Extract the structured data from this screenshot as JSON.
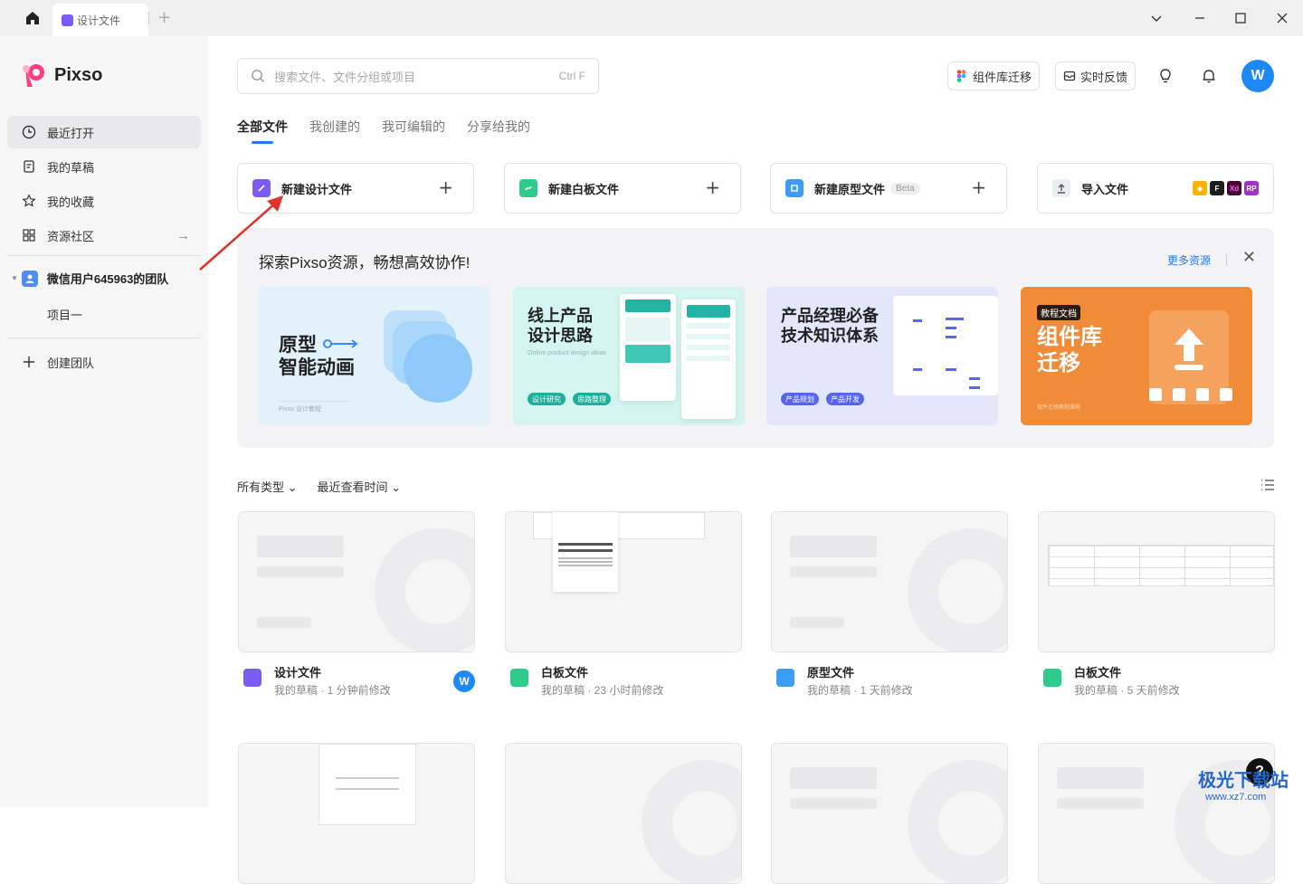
{
  "titlebar": {
    "tab_label": "设计文件"
  },
  "sidebar": {
    "brand": "Pixso",
    "items": [
      {
        "label": "最近打开"
      },
      {
        "label": "我的草稿"
      },
      {
        "label": "我的收藏"
      },
      {
        "label": "资源社区"
      }
    ],
    "team_name": "微信用户645963的团队",
    "project": "项目一",
    "create_team": "创建团队"
  },
  "header": {
    "search_placeholder": "搜索文件、文件分组或项目",
    "search_shortcut": "Ctrl F",
    "migrate_label": "组件库迁移",
    "feedback_label": "实时反馈",
    "avatar_initial": "W"
  },
  "tabs": [
    "全部文件",
    "我创建的",
    "我可编辑的",
    "分享给我的"
  ],
  "create_cards": [
    {
      "label": "新建设计文件",
      "color": "#7b5cf5"
    },
    {
      "label": "新建白板文件",
      "color": "#2ecb8a"
    },
    {
      "label": "新建原型文件",
      "badge": "Beta",
      "color": "#3c9cf8"
    },
    {
      "label": "导入文件",
      "color": "#e9eef5",
      "formats": [
        "Xd",
        "RP"
      ]
    }
  ],
  "explore": {
    "title": "探索Pixso资源，畅想高效协作!",
    "more_label": "更多资源",
    "banners": [
      {
        "title_line1": "原型",
        "title_line2": "智能动画",
        "footer": "Pixso 设计教程"
      },
      {
        "title_line1": "线上产品",
        "title_line2": "设计思路",
        "subtitle": "Online product design ideas",
        "chips": [
          "设计研究",
          "思路整理"
        ]
      },
      {
        "title_line1": "产品经理必备",
        "title_line2": "技术知识体系",
        "chips": [
          "产品规划",
          "产品开发"
        ]
      },
      {
        "tag": "教程文档",
        "title_line1": "组件库",
        "title_line2": "迁移",
        "footer": "组件迁移教程课程"
      }
    ]
  },
  "filters": {
    "type": "所有类型",
    "sort": "最近查看时间"
  },
  "files": [
    {
      "name": "设计文件",
      "meta": "我的草稿 · 1 分钟前修改",
      "color": "#7b5cf5",
      "owner": "W"
    },
    {
      "name": "白板文件",
      "meta": "我的草稿 · 23 小时前修改",
      "color": "#2ecb8a"
    },
    {
      "name": "原型文件",
      "meta": "我的草稿 · 1 天前修改",
      "color": "#3c9cf8"
    },
    {
      "name": "白板文件",
      "meta": "我的草稿 · 5 天前修改",
      "color": "#2ecb8a"
    }
  ],
  "help_label": "?",
  "watermark": {
    "line1": "极光下载站",
    "line2": "www.xz7.com"
  }
}
